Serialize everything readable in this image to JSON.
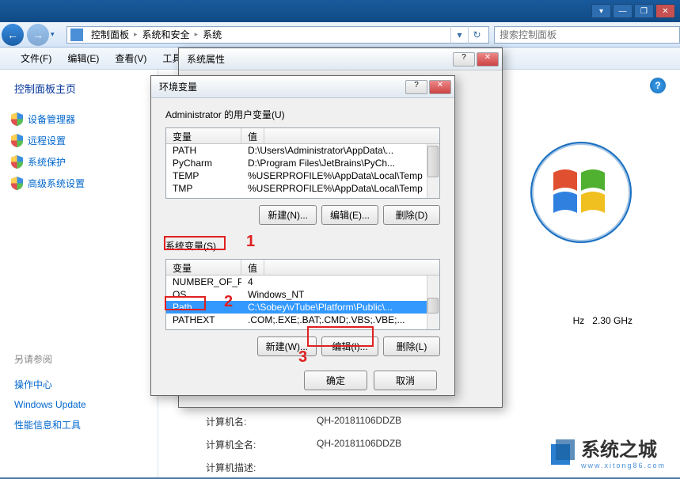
{
  "titlebar": {
    "dd": "▾",
    "min": "—",
    "max": "❐",
    "close": "✕"
  },
  "nav": {
    "back": "←",
    "fwd": "→",
    "dd": "▾",
    "refresh": "↻",
    "go": "▾"
  },
  "breadcrumb": {
    "items": [
      "控制面板",
      "系统和安全",
      "系统"
    ],
    "sep": "▸"
  },
  "search": {
    "placeholder": "搜索控制面板"
  },
  "menu": {
    "file": "文件(F)",
    "edit": "编辑(E)",
    "view": "查看(V)",
    "tools": "工具"
  },
  "sidebar": {
    "title": "控制面板主页",
    "links": [
      "设备管理器",
      "远程设置",
      "系统保护",
      "高级系统设置"
    ],
    "also_title": "另请参阅",
    "also": [
      "操作中心",
      "Windows Update",
      "性能信息和工具"
    ]
  },
  "content": {
    "ghz_label": "Hz",
    "ghz_val": "2.30 GHz",
    "cname_lbl": "计算机名:",
    "cname_val": "QH-20181106DDZB",
    "cfull_lbl": "计算机全名:",
    "cfull_val": "QH-20181106DDZB",
    "cdesc_lbl": "计算机描述:",
    "help": "?"
  },
  "modal1": {
    "title": "系统属性",
    "help": "?",
    "close": "✕"
  },
  "modal2": {
    "title": "环境变量",
    "help": "?",
    "close": "✕",
    "user_label": "Administrator 的用户变量(U)",
    "hdr_var": "变量",
    "hdr_val": "值",
    "user_vars": [
      {
        "n": "PATH",
        "v": "D:\\Users\\Administrator\\AppData\\..."
      },
      {
        "n": "PyCharm",
        "v": "D:\\Program Files\\JetBrains\\PyCh..."
      },
      {
        "n": "TEMP",
        "v": "%USERPROFILE%\\AppData\\Local\\Temp"
      },
      {
        "n": "TMP",
        "v": "%USERPROFILE%\\AppData\\Local\\Temp"
      }
    ],
    "sys_label": "系统变量(S)",
    "sys_vars": [
      {
        "n": "NUMBER_OF_PR...",
        "v": "4"
      },
      {
        "n": "OS",
        "v": "Windows_NT"
      },
      {
        "n": "Path",
        "v": "C:\\Sobey\\vTube\\Platform\\Public\\..."
      },
      {
        "n": "PATHEXT",
        "v": ".COM;.EXE;.BAT;.CMD;.VBS;.VBE;..."
      }
    ],
    "btn_new_n": "新建(N)...",
    "btn_edit_e": "编辑(E)...",
    "btn_del_d": "删除(D)",
    "btn_new_w": "新建(W)...",
    "btn_edit_i": "编辑(I)...",
    "btn_del_l": "删除(L)",
    "ok": "确定",
    "cancel": "取消"
  },
  "annot": {
    "n1": "1",
    "n2": "2",
    "n3": "3"
  },
  "watermark": {
    "txt": "系统之城",
    "sub": "www.xitong86.com"
  }
}
